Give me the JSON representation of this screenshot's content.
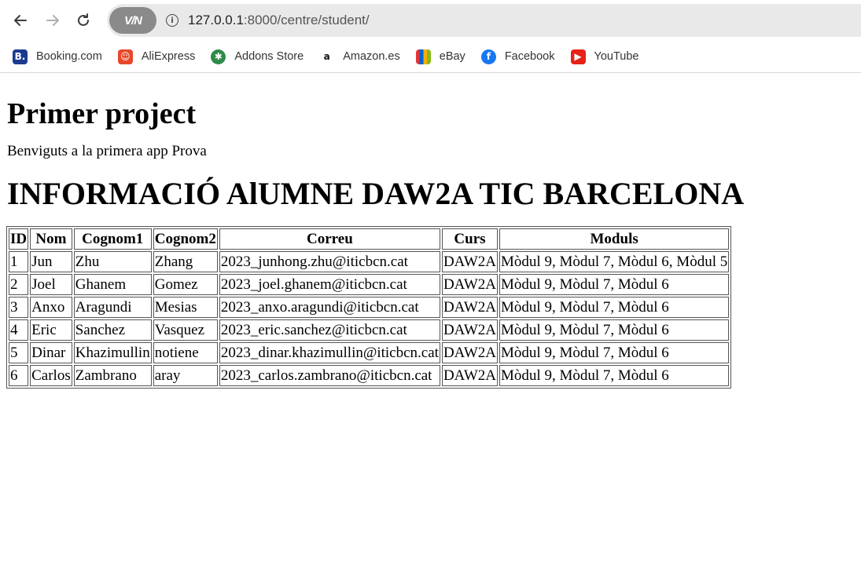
{
  "browser": {
    "url_host": "127.0.0.1",
    "url_rest": ":8000/centre/student/",
    "vpn_label": "V/N",
    "bookmarks": [
      {
        "label": "Booking.com",
        "icon": "booking-icon",
        "glyph": "B.",
        "color": "#1a3c8f"
      },
      {
        "label": "AliExpress",
        "icon": "aliexpress-icon",
        "glyph": "☺",
        "color": "#e8472b"
      },
      {
        "label": "Addons Store",
        "icon": "addons-store-icon",
        "glyph": "✱",
        "color": "#2e8b4a"
      },
      {
        "label": "Amazon.es",
        "icon": "amazon-icon",
        "glyph": "a",
        "color": "#ffffff"
      },
      {
        "label": "eBay",
        "icon": "ebay-icon",
        "glyph": "▮",
        "color": "#ffffff"
      },
      {
        "label": "Facebook",
        "icon": "facebook-icon",
        "glyph": "f",
        "color": "#1877f2"
      },
      {
        "label": "YouTube",
        "icon": "youtube-icon",
        "glyph": "▶",
        "color": "#e62117"
      }
    ]
  },
  "page": {
    "title": "Primer project",
    "intro": "Benviguts a la primera app Prova",
    "heading": "INFORMACIÓ AlUMNE DAW2A TIC BARCELONA"
  },
  "table": {
    "headers": [
      "ID",
      "Nom",
      "Cognom1",
      "Cognom2",
      "Correu",
      "Curs",
      "Moduls"
    ],
    "rows": [
      [
        "1",
        "Jun",
        "Zhu",
        "Zhang",
        "2023_junhong.zhu@iticbcn.cat",
        "DAW2A",
        "Mòdul 9, Mòdul 7, Mòdul 6, Mòdul 5"
      ],
      [
        "2",
        "Joel",
        "Ghanem",
        "Gomez",
        "2023_joel.ghanem@iticbcn.cat",
        "DAW2A",
        "Mòdul 9, Mòdul 7, Mòdul 6"
      ],
      [
        "3",
        "Anxo",
        "Aragundi",
        "Mesias",
        "2023_anxo.aragundi@iticbcn.cat",
        "DAW2A",
        "Mòdul 9, Mòdul 7, Mòdul 6"
      ],
      [
        "4",
        "Eric",
        "Sanchez",
        "Vasquez",
        "2023_eric.sanchez@iticbcn.cat",
        "DAW2A",
        "Mòdul 9, Mòdul 7, Mòdul 6"
      ],
      [
        "5",
        "Dinar",
        "Khazimullin",
        "notiene",
        "2023_dinar.khazimullin@iticbcn.cat",
        "DAW2A",
        "Mòdul 9, Mòdul 7, Mòdul 6"
      ],
      [
        "6",
        "Carlos",
        "Zambrano",
        "aray",
        "2023_carlos.zambrano@iticbcn.cat",
        "DAW2A",
        "Mòdul 9, Mòdul 7, Mòdul 6"
      ]
    ]
  }
}
